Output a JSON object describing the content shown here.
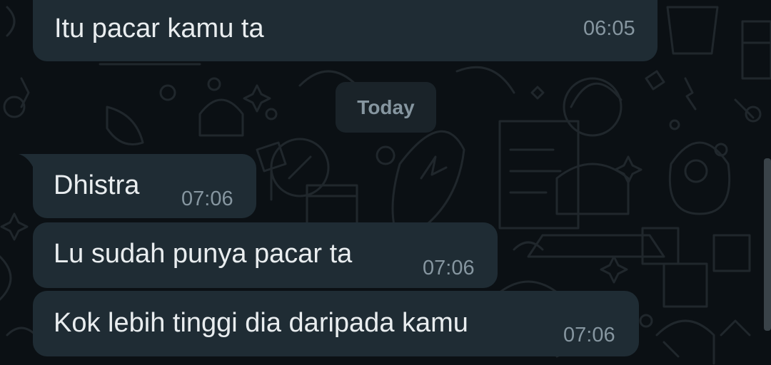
{
  "messages_before": [
    {
      "text": "Itu pacar kamu ta",
      "time": "06:05"
    }
  ],
  "date_divider": "Today",
  "messages_today": [
    {
      "text": "Dhistra",
      "time": "07:06"
    },
    {
      "text": "Lu sudah punya pacar ta",
      "time": "07:06"
    },
    {
      "text": "Kok lebih tinggi dia daripada kamu",
      "time": "07:06"
    }
  ],
  "colors": {
    "background": "#0b1014",
    "incoming_bubble": "#1f2c34",
    "text": "#e9edef",
    "timestamp": "#8696a0"
  }
}
